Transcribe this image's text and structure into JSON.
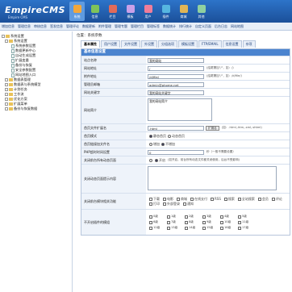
{
  "logo": {
    "title": "EmpireCMS",
    "subtitle": "Empire CMS"
  },
  "topnav": [
    {
      "label": "系统",
      "color": "#f2a73b"
    },
    {
      "label": "信息",
      "color": "#7fc35a"
    },
    {
      "label": "栏目",
      "color": "#e06b5a"
    },
    {
      "label": "模板",
      "color": "#c9a0e8"
    },
    {
      "label": "用户",
      "color": "#f07d9a"
    },
    {
      "label": "插件",
      "color": "#56b6e0"
    },
    {
      "label": "商城",
      "color": "#e0b556"
    },
    {
      "label": "其他",
      "color": "#8fd0a0"
    }
  ],
  "subnav": [
    "增加信息",
    "管理信息",
    "审核信息",
    "签发信息",
    "管理评论",
    "数据更新",
    "附件管理",
    "管理专题",
    "管理栏目",
    "管理标签",
    "数据统计",
    "排行统计",
    "自定义页面",
    "后台日志",
    "网站地图"
  ],
  "sidebar": [
    {
      "label": "系统设置",
      "indent": 0,
      "kind": "folder"
    },
    {
      "label": "系统设置",
      "indent": 1,
      "kind": "folder"
    },
    {
      "label": "系统参数设置",
      "indent": 2,
      "kind": "page"
    },
    {
      "label": "数据更新中心",
      "indent": 2,
      "kind": "page"
    },
    {
      "label": "自动生成设置",
      "indent": 2,
      "kind": "page"
    },
    {
      "label": "扩展变量",
      "indent": 2,
      "kind": "page"
    },
    {
      "label": "备份与恢复",
      "indent": 2,
      "kind": "page"
    },
    {
      "label": "安全参数配置",
      "indent": 2,
      "kind": "page"
    },
    {
      "label": "网站地图入口",
      "indent": 2,
      "kind": "page"
    },
    {
      "label": "数据表管理",
      "indent": 1,
      "kind": "folder"
    },
    {
      "label": "数据表与系统模型",
      "indent": 1,
      "kind": "folder"
    },
    {
      "label": "计划任务",
      "indent": 1,
      "kind": "folder"
    },
    {
      "label": "工作流",
      "indent": 1,
      "kind": "folder"
    },
    {
      "label": "优化方案",
      "indent": 1,
      "kind": "folder"
    },
    {
      "label": "扩展菜单",
      "indent": 1,
      "kind": "folder"
    },
    {
      "label": "备份与恢复数据",
      "indent": 1,
      "kind": "folder"
    }
  ],
  "breadcrumb": "位置：系统参数",
  "tabs": [
    "基本属性",
    "用户设置",
    "文件设置",
    "外设置",
    "分组选项",
    "模板设置",
    "FTP/EMAIL",
    "信息设置",
    "杂项"
  ],
  "form": {
    "head": "基本信息设置",
    "site_name_label": "站点名称",
    "site_name_value": "我的网站",
    "site_url_label": "网站地址",
    "site_url_value": "/",
    "site_url_hint": "(结尾需加\"/\"，如：/)",
    "attach_url_label": "附件地址",
    "attach_url_value": "/d/file/",
    "attach_url_hint": "(结尾需加\"/\"，如：/d/file/)",
    "admin_email_label": "管理员邮箱",
    "admin_email_value": "admin@phome.net",
    "keywords_label": "网站关键字",
    "keywords_value": "我的网站关键字",
    "desc_label": "网站简介",
    "desc_value": "我的网站简介",
    "index_ext_label": "首页文件扩展名",
    "index_ext_value": ".html",
    "index_ext_btn": "扩展名",
    "index_ext_hint": "(如：.html,.htm,.xml,.shtml)",
    "index_mode_label": "首页模式",
    "index_mode_options": [
      "静态首页",
      "动态首页"
    ],
    "index_list_label": "首页链接加文件名",
    "index_list_options": [
      "增加",
      "不增加"
    ],
    "php_timeout_label": "PHP超时时间设置",
    "php_timeout_value": "0",
    "php_timeout_hint": "秒（一般不需要设置）",
    "front_label": "关闭前台所有动态页面",
    "front_value": "开启",
    "front_hint": "(如开启，前台所有动态文件都关闭使用，后台不受影响)",
    "close_tip_label": "关闭动态页面提示内容",
    "closed_modules_label": "关闭前台模块相关功能",
    "closed_modules": [
      "下载",
      "电影",
      "商城",
      "在线支付",
      "RSS",
      "搜索",
      "全站搜索",
      "会员",
      "评论",
      "打印",
      "外部登录",
      "通知"
    ],
    "limit_label": "不开启插件的模组",
    "limit_grid": [
      "0级",
      "1级",
      "2级",
      "3级",
      "4级",
      "5级",
      "6级",
      "7级",
      "8级",
      "9级",
      "10级",
      "11级",
      "12级",
      "13级",
      "14级",
      "15级",
      "16级",
      "17级"
    ]
  }
}
